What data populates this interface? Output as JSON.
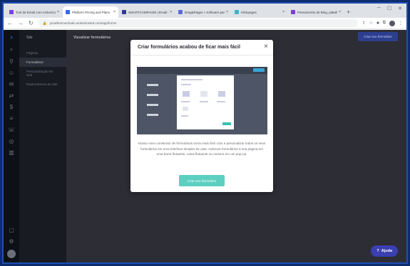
{
  "browser": {
    "tabs": [
      {
        "title": "Tool de Email com ActiveCampai",
        "color": "#7b3fe4",
        "active": false
      },
      {
        "title": "Platform Pricing and Plans",
        "color": "#356ae6",
        "active": true
      },
      {
        "title": "SMARTCAMPAIGN | Email M",
        "color": "#2f3a8f",
        "active": false
      },
      {
        "title": "Drag&Pages » Software para cria",
        "color": "#5b6bd6",
        "active": false
      },
      {
        "title": "Klickpages",
        "color": "#43b0c8",
        "active": false
      },
      {
        "title": "Pensamento de Blog, plataformas",
        "color": "#7a3fcc",
        "active": false
      }
    ],
    "url": "jonathenmachado.activehosted.com/app/forms",
    "tab_close_glyph": "×",
    "newtab_glyph": "+"
  },
  "rail": {
    "icons": [
      "logo-icon",
      "search-icon",
      "location-icon",
      "contacts-icon",
      "email-icon",
      "automation-icon",
      "deals-icon",
      "lists-icon",
      "conversations-icon",
      "website-icon",
      "reports-icon"
    ],
    "bottom_icons": [
      "pages-icon",
      "settings-icon"
    ]
  },
  "subnav": {
    "header": "Site",
    "items": [
      {
        "label": "Páginas",
        "active": false
      },
      {
        "label": "Formulários",
        "active": true
      },
      {
        "label": "Personalização do web",
        "active": false
      },
      {
        "label": "Rastreamento do Site",
        "active": false
      }
    ]
  },
  "main": {
    "page_title": "Visualizar formulários",
    "create_button": "Criar seu formulário",
    "help_button": "Ajuda"
  },
  "modal": {
    "title": "Criar formulários acabou de ficar mais fácil",
    "description": "Nosso novo construtor de formulários torna mais fácil criar e personalizar todos os seus formulários em uma interface simples de usar. Adicione formulários à sua página em uma barra flutuante, caixa flutuante ou mesmo em um pop-up.",
    "cta": "Criar seu formulário"
  }
}
